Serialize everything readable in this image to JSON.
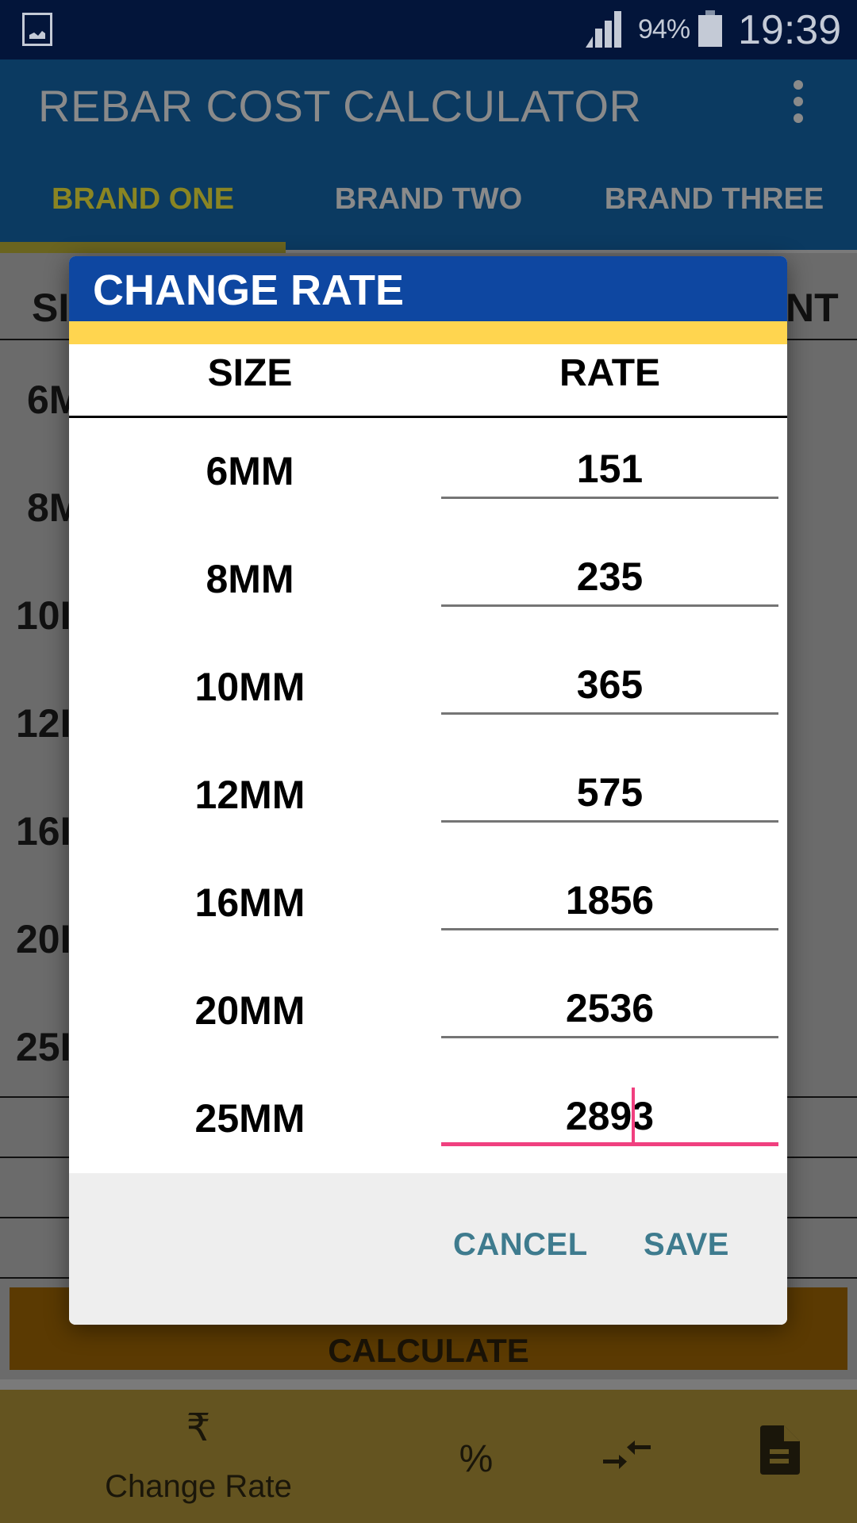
{
  "status_bar": {
    "battery_percent": "94%",
    "time": "19:39",
    "icons": [
      "gallery-notification-icon",
      "signal-icon",
      "battery-icon"
    ]
  },
  "app": {
    "title": "REBAR COST CALCULATOR",
    "menu_icon": "more-vert-icon",
    "tabs": [
      {
        "label": "BRAND ONE",
        "active": true
      },
      {
        "label": "BRAND TWO",
        "active": false
      },
      {
        "label": "BRAND THREE",
        "active": false
      }
    ],
    "background_table": {
      "header_left_partial": "SI",
      "header_right_partial": "NT",
      "size_partials": [
        "6M",
        "8M",
        "10I",
        "12I",
        "16I",
        "20I",
        "25I"
      ]
    },
    "calculate_label": "CALCULATE",
    "bottom_nav": [
      {
        "icon": "rupee-icon",
        "glyph": "₹",
        "label": "Change Rate"
      },
      {
        "icon": "percent-icon",
        "glyph": "%",
        "label": ""
      },
      {
        "icon": "compare-arrows-icon",
        "glyph": "",
        "label": ""
      },
      {
        "icon": "document-icon",
        "glyph": "",
        "label": ""
      }
    ]
  },
  "dialog": {
    "title": "CHANGE RATE",
    "column_size": "SIZE",
    "column_rate": "RATE",
    "rows": [
      {
        "size": "6MM",
        "rate": "151"
      },
      {
        "size": "8MM",
        "rate": "235"
      },
      {
        "size": "10MM",
        "rate": "365"
      },
      {
        "size": "12MM",
        "rate": "575"
      },
      {
        "size": "16MM",
        "rate": "1856"
      },
      {
        "size": "20MM",
        "rate": "2536"
      },
      {
        "size": "25MM",
        "rate": "2893",
        "focused": true
      }
    ],
    "cancel_label": "CANCEL",
    "save_label": "SAVE"
  },
  "colors": {
    "dialog_title_bg": "#0e47a1",
    "dialog_stripe": "#ffd54f",
    "focus_accent": "#f0407f",
    "action_text": "#3e7b8e"
  }
}
